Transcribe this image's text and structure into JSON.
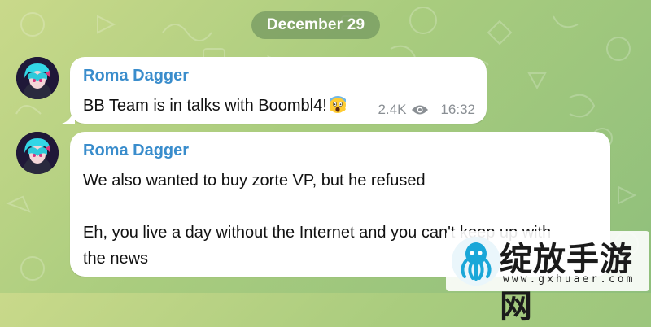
{
  "chat": {
    "date_separator": "December 29",
    "messages": [
      {
        "sender": "Roma Dagger",
        "text": "BB Team is in talks with Boombl4!",
        "emoji": "screaming-face-emoji",
        "views": "2.4K",
        "time": "16:32"
      },
      {
        "sender": "Roma Dagger",
        "text_line1": "We also wanted to buy zorte VP, but he refused",
        "text_line2": "Eh, you live a day without the Internet and you can't keep up with",
        "text_line3": "the news"
      }
    ]
  },
  "watermark": {
    "title": "绽放手游网",
    "url": "www.gxhuaer.com"
  },
  "colors": {
    "sender": "#3a8dcc",
    "meta": "#8a8f94",
    "date_chip": "#74985f"
  }
}
